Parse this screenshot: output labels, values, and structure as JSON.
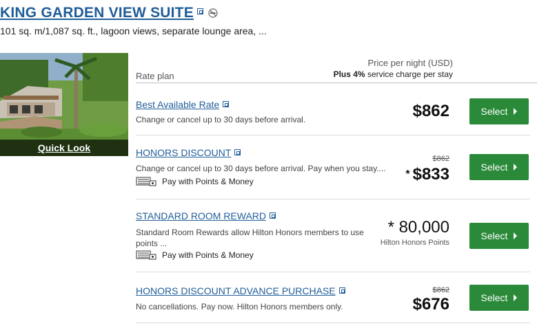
{
  "room": {
    "title": "KING GARDEN VIEW SUITE",
    "description": "101 sq. m/1,087 sq. ft., lagoon views, separate lounge area, ...",
    "quick_look": "Quick Look"
  },
  "table_header": {
    "rate_plan": "Rate plan",
    "price_per_night": "Price per night (USD)",
    "service_prefix": "Plus 4%",
    "service_suffix": " service charge per stay"
  },
  "rates": [
    {
      "name": "Best Available Rate",
      "description": "Change or cancel up to 30 days before arrival.",
      "price": "$862",
      "select_label": "Select"
    },
    {
      "name": "HONORS DISCOUNT",
      "description": "Change or cancel up to 30 days before arrival. Pay when you stay....",
      "pay_points_money": "Pay with Points & Money",
      "original_price": "$862",
      "price_star": "*",
      "price": "$833",
      "select_label": "Select"
    },
    {
      "name": "STANDARD ROOM REWARD",
      "description_line1": "Standard Room Rewards allow Hilton Honors members to use",
      "description_line2": "points ...",
      "pay_points_money": "Pay with Points & Money",
      "points": "* 80,000",
      "points_unit": "Hilton Honors Points",
      "select_label": "Select"
    },
    {
      "name": "HONORS DISCOUNT ADVANCE PURCHASE",
      "description": "No cancellations. Pay now. Hilton Honors members only.",
      "original_price": "$862",
      "price": "$676",
      "select_label": "Select"
    }
  ],
  "colors": {
    "link_blue": "#1f5d99",
    "select_green": "#2a8a39"
  }
}
